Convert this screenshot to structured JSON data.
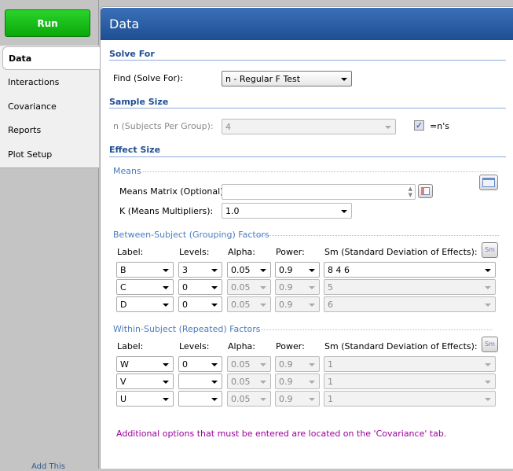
{
  "sidebar": {
    "run": "Run",
    "tabs": [
      "Data",
      "Interactions",
      "Covariance",
      "Reports",
      "Plot Setup"
    ],
    "footer": "Add This"
  },
  "header": {
    "title": "Data"
  },
  "solve_for": {
    "heading": "Solve For",
    "label": "Find (Solve For):",
    "value": "n - Regular F Test"
  },
  "sample_size": {
    "heading": "Sample Size",
    "label": "n (Subjects Per Group):",
    "value": "4",
    "checkbox_label": "=n's",
    "checked": true
  },
  "effect_size": {
    "heading": "Effect Size",
    "means_heading": "Means",
    "means_matrix_label": "Means Matrix (Optional):",
    "means_matrix_value": "",
    "k_label": "K (Means Multipliers):",
    "k_value": "1.0"
  },
  "columns": [
    "Label:",
    "Levels:",
    "Alpha:",
    "Power:",
    "Sm (Standard Deviation of Effects):"
  ],
  "between": {
    "heading": "Between-Subject (Grouping) Factors",
    "rows": [
      {
        "label": "B",
        "levels": "3",
        "alpha": "0.05",
        "power": "0.9",
        "sm": "8 4 6",
        "enabled": true
      },
      {
        "label": "C",
        "levels": "0",
        "alpha": "0.05",
        "power": "0.9",
        "sm": "5",
        "enabled": false
      },
      {
        "label": "D",
        "levels": "0",
        "alpha": "0.05",
        "power": "0.9",
        "sm": "6",
        "enabled": false
      }
    ]
  },
  "within": {
    "heading": "Within-Subject (Repeated) Factors",
    "rows": [
      {
        "label": "W",
        "levels": "0",
        "alpha": "0.05",
        "power": "0.9",
        "sm": "1",
        "enabled": false
      },
      {
        "label": "V",
        "levels": "",
        "alpha": "0.05",
        "power": "0.9",
        "sm": "1",
        "enabled": false
      },
      {
        "label": "U",
        "levels": "",
        "alpha": "0.05",
        "power": "0.9",
        "sm": "1",
        "enabled": false
      }
    ]
  },
  "note": "Additional options that must be entered are located on the 'Covariance' tab."
}
